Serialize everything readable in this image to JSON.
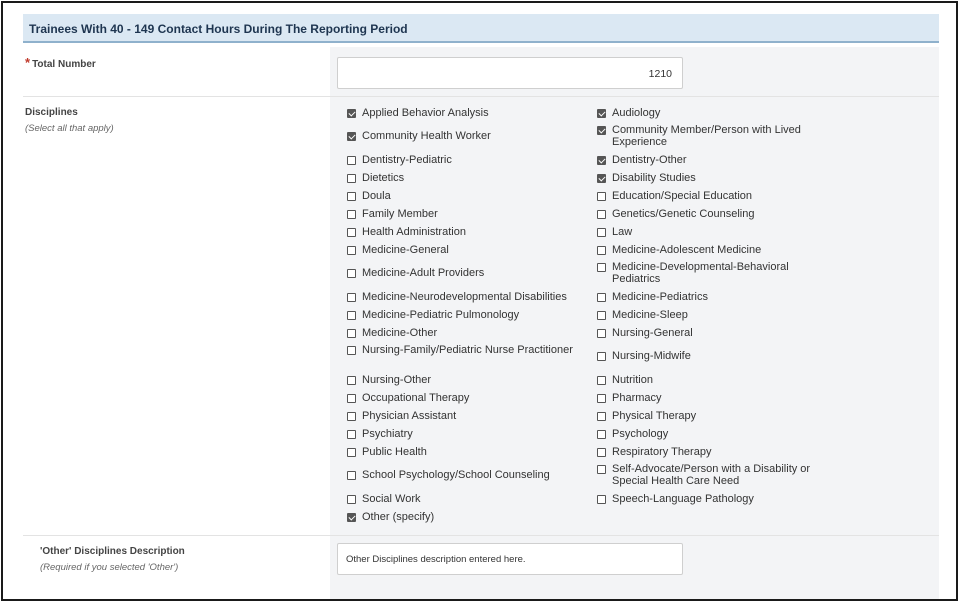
{
  "section": {
    "title": "Trainees With 40 - 149 Contact Hours During The Reporting Period"
  },
  "total_number": {
    "label": "Total Number",
    "required_marker": "*",
    "value": "1210"
  },
  "disciplines": {
    "label": "Disciplines",
    "hint": "(Select all that apply)",
    "left": [
      {
        "label": "Applied Behavior Analysis",
        "checked": true
      },
      {
        "label": "Community Health Worker",
        "checked": true
      },
      {
        "label": "Dentistry-Pediatric",
        "checked": false
      },
      {
        "label": "Dietetics",
        "checked": false
      },
      {
        "label": "Doula",
        "checked": false
      },
      {
        "label": "Family Member",
        "checked": false
      },
      {
        "label": "Health Administration",
        "checked": false
      },
      {
        "label": "Medicine-General",
        "checked": false
      },
      {
        "label": "Medicine-Adult Providers",
        "checked": false
      },
      {
        "label": "Medicine-Neurodevelopmental Disabilities",
        "checked": false
      },
      {
        "label": "Medicine-Pediatric Pulmonology",
        "checked": false
      },
      {
        "label": "Medicine-Other",
        "checked": false
      },
      {
        "label": "Nursing-Family/Pediatric Nurse Practitioner",
        "checked": false
      },
      {
        "label": "Nursing-Other",
        "checked": false
      },
      {
        "label": "Occupational Therapy",
        "checked": false
      },
      {
        "label": "Physician Assistant",
        "checked": false
      },
      {
        "label": "Psychiatry",
        "checked": false
      },
      {
        "label": "Public Health",
        "checked": false
      },
      {
        "label": "School Psychology/School Counseling",
        "checked": false
      },
      {
        "label": "Social Work",
        "checked": false
      },
      {
        "label": "Other (specify)",
        "checked": true
      }
    ],
    "right": [
      {
        "label": "Audiology",
        "checked": true
      },
      {
        "label": "Community Member/Person with Lived Experience",
        "checked": true
      },
      {
        "label": "Dentistry-Other",
        "checked": true
      },
      {
        "label": "Disability Studies",
        "checked": true
      },
      {
        "label": "Education/Special Education",
        "checked": false
      },
      {
        "label": "Genetics/Genetic Counseling",
        "checked": false
      },
      {
        "label": "Law",
        "checked": false
      },
      {
        "label": "Medicine-Adolescent Medicine",
        "checked": false
      },
      {
        "label": "Medicine-Developmental-Behavioral Pediatrics",
        "checked": false
      },
      {
        "label": "Medicine-Pediatrics",
        "checked": false
      },
      {
        "label": "Medicine-Sleep",
        "checked": false
      },
      {
        "label": "Nursing-General",
        "checked": false
      },
      {
        "label": "Nursing-Midwife",
        "checked": false
      },
      {
        "label": "Nutrition",
        "checked": false
      },
      {
        "label": "Pharmacy",
        "checked": false
      },
      {
        "label": "Physical Therapy",
        "checked": false
      },
      {
        "label": "Psychology",
        "checked": false
      },
      {
        "label": "Respiratory Therapy",
        "checked": false
      },
      {
        "label": "Self-Advocate/Person with a Disability or Special Health Care Need",
        "checked": false
      },
      {
        "label": "Speech-Language Pathology",
        "checked": false
      }
    ]
  },
  "other_description": {
    "label": "'Other' Disciplines Description",
    "hint": "(Required if you selected 'Other')",
    "value": "Other Disciplines description entered here."
  }
}
